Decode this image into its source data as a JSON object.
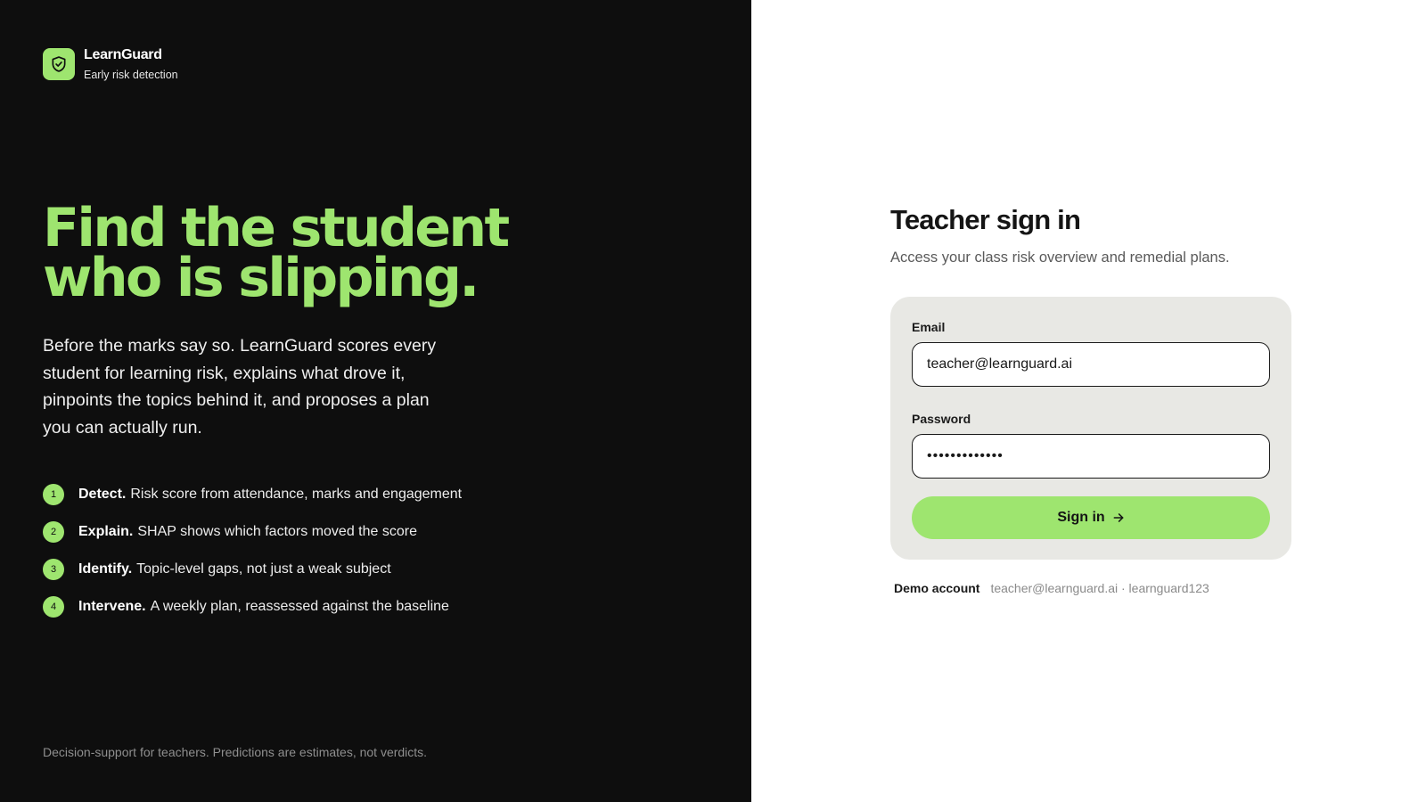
{
  "brand": {
    "name": "LearnGuard",
    "tagline": "Early risk detection",
    "logo_icon": "shield-check-icon",
    "accent_color": "#9ee56f"
  },
  "hero": {
    "headline_line1": "Find the student",
    "headline_line2": "who is slipping.",
    "intro": "Before the marks say so. LearnGuard scores every student for learning risk, explains what drove it, pinpoints the topics behind it, and proposes a plan you can actually run."
  },
  "steps": [
    {
      "number": "1",
      "title": "Detect.",
      "text": "Risk score from attendance, marks and engagement"
    },
    {
      "number": "2",
      "title": "Explain.",
      "text": "SHAP shows which factors moved the score"
    },
    {
      "number": "3",
      "title": "Identify.",
      "text": "Topic-level gaps, not just a weak subject"
    },
    {
      "number": "4",
      "title": "Intervene.",
      "text": "A weekly plan, reassessed against the baseline"
    }
  ],
  "disclaimer": "Decision-support for teachers. Predictions are estimates, not verdicts.",
  "signin": {
    "title": "Teacher sign in",
    "subtitle": "Access your class risk overview and remedial plans.",
    "email_label": "Email",
    "email_value": "teacher@learnguard.ai",
    "password_label": "Password",
    "password_value": "learnguard123",
    "button_label": "Sign in",
    "button_icon": "arrow-right-icon"
  },
  "demo": {
    "label": "Demo account",
    "credentials": "teacher@learnguard.ai · learnguard123"
  }
}
